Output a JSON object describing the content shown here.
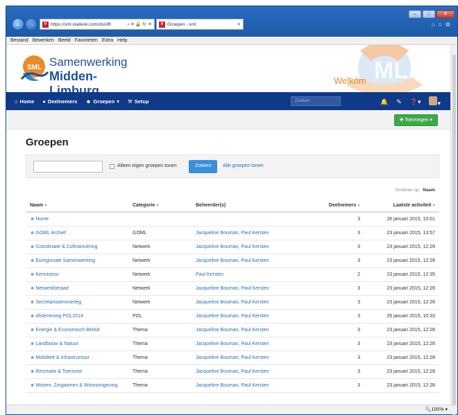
{
  "browser": {
    "url": "https://sml.viadesk.com/do/offi",
    "addr_tools": "⌕ ▾ 🔒 ↻ ✕",
    "tab_title": "Groepen - sml",
    "favicon_letter": "V",
    "menu": [
      "Bestand",
      "Bewerken",
      "Beeld",
      "Favorieten",
      "Extra",
      "Help"
    ],
    "zoom": "🔍100%  ▾"
  },
  "header": {
    "logo_line1": "Samenwerking",
    "logo_line2": "Midden-Limburg",
    "logo_mark": "SML",
    "welcome": "Welkom"
  },
  "nav": {
    "home": "Home",
    "members": "Deelnemers",
    "groups": "Groepen",
    "setup": "Setup",
    "search_placeholder": "Zoeken"
  },
  "toolbar": {
    "add_label": "Toevoegen"
  },
  "page": {
    "title": "Groepen",
    "only_own_label": "Alleen eigen groepen tonen",
    "search_button": "Zoeken",
    "show_all_link": "Alle groepen tonen",
    "sort_prefix": "Sorteren op:",
    "sort_value": "Naam"
  },
  "table": {
    "headers": [
      "Naam",
      "Categorie",
      "Beheerder(s)",
      "Deelnemers",
      "Laatste activiteit"
    ],
    "rows": [
      {
        "name": "Home",
        "category": "",
        "admins": "",
        "members": "3",
        "last": "26 januari 2015, 10:01"
      },
      {
        "name": "GOML Archief",
        "category": "GOML",
        "admins": "Jacqueline Bouman, Paul Kersten",
        "members": "3",
        "last": "23 januari 2015, 13:57"
      },
      {
        "name": "Coördinatie & Cofinanciering",
        "category": "Netwerk",
        "admins": "Jacqueline Bouman, Paul Kersten",
        "members": "3",
        "last": "23 januari 2015, 12:28"
      },
      {
        "name": "Euregionale Samenwerking",
        "category": "Netwerk",
        "admins": "Jacqueline Bouman, Paul Kersten",
        "members": "3",
        "last": "23 januari 2015, 12:28"
      },
      {
        "name": "Kennistour",
        "category": "Netwerk",
        "admins": "Paul Kersten",
        "members": "2",
        "last": "23 januari 2015, 12:35"
      },
      {
        "name": "Netwerkberaad",
        "category": "Netwerk",
        "admins": "Jacqueline Bouman, Paul Kersten",
        "members": "3",
        "last": "23 januari 2015, 12:28"
      },
      {
        "name": "Secretarissenoverleg",
        "category": "Netwerk",
        "admins": "Jacqueline Bouman, Paul Kersten",
        "members": "3",
        "last": "23 januari 2015, 12:28"
      },
      {
        "name": "Afstemming POL2014",
        "category": "POL",
        "admins": "Jacqueline Bouman, Paul Kersten",
        "members": "3",
        "last": "26 januari 2015, 10:33"
      },
      {
        "name": "Energie & Economisch Beleid",
        "category": "Thema",
        "admins": "Jacqueline Bouman, Paul Kersten",
        "members": "3",
        "last": "23 januari 2015, 12:28"
      },
      {
        "name": "Landbouw & Natuur",
        "category": "Thema",
        "admins": "Jacqueline Bouman, Paul Kersten",
        "members": "3",
        "last": "23 januari 2015, 12:28"
      },
      {
        "name": "Mobiliteit & Infrastructuur",
        "category": "Thema",
        "admins": "Jacqueline Bouman, Paul Kersten",
        "members": "3",
        "last": "23 januari 2015, 12:28"
      },
      {
        "name": "Recreatie & Toerisme",
        "category": "Thema",
        "admins": "Jacqueline Bouman, Paul Kersten",
        "members": "3",
        "last": "23 januari 2015, 12:28"
      },
      {
        "name": "Wonen, Zorgwonen & Woonomgeving",
        "category": "Thema",
        "admins": "Jacqueline Bouman, Paul Kersten",
        "members": "3",
        "last": "23 januari 2015, 12:28"
      }
    ]
  },
  "colors": {
    "navbar": "#0f3a88",
    "accent_blue": "#2a6db6",
    "add_green": "#3ea84a",
    "welcome_orange": "#e98b2a"
  }
}
